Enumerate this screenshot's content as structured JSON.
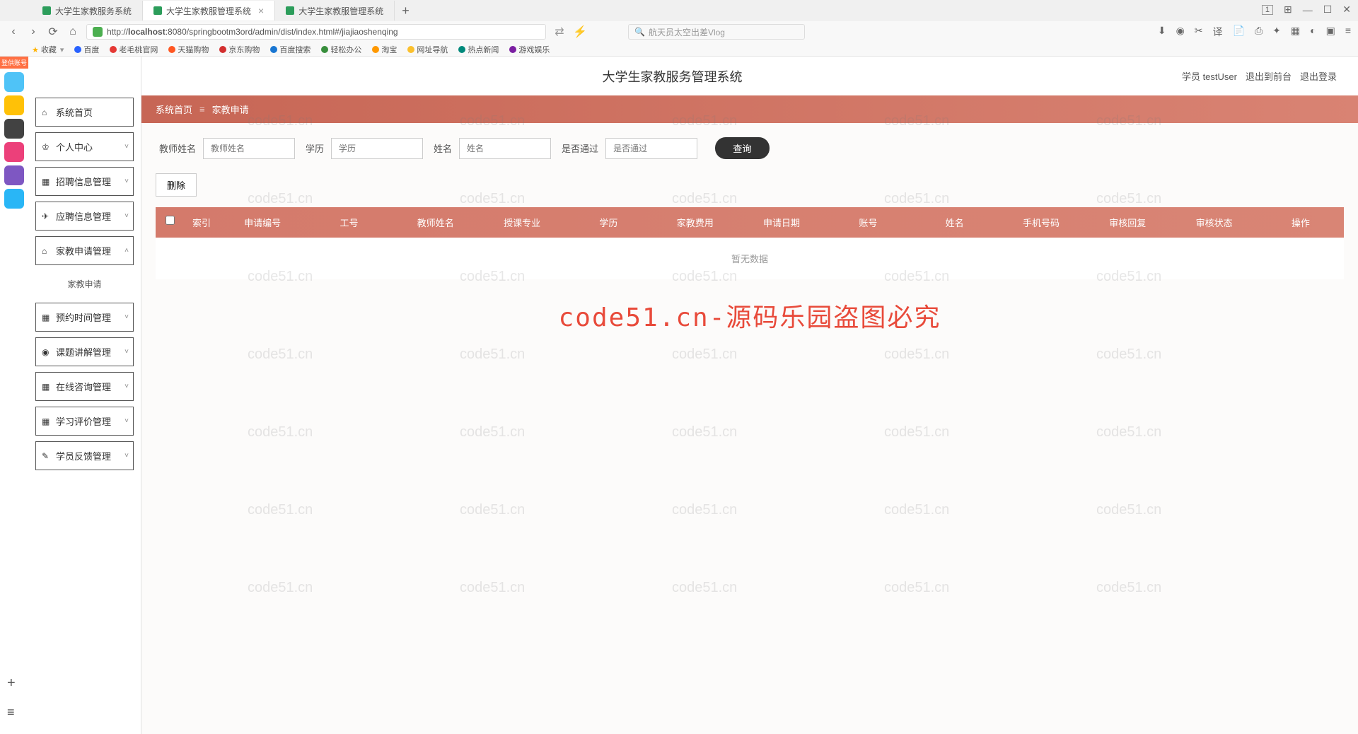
{
  "browser": {
    "tabs": [
      {
        "title": "大学生家教服务系统",
        "active": false
      },
      {
        "title": "大学生家教服管理系统",
        "active": true
      },
      {
        "title": "大学生家教服管理系统",
        "active": false
      }
    ],
    "url_prefix": "http://",
    "url_host": "localhost",
    "url_path": ":8080/springbootm3ord/admin/dist/index.html#/jiajiaoshenqing",
    "search_placeholder": "航天员太空出差Vlog",
    "win_num": "1",
    "bookmarks": [
      {
        "label": "收藏",
        "color": "#ffb300"
      },
      {
        "label": "百度",
        "color": "#2962ff"
      },
      {
        "label": "老毛桃官网",
        "color": "#e53935"
      },
      {
        "label": "天猫购物",
        "color": "#ff5722"
      },
      {
        "label": "京东购物",
        "color": "#d32f2f"
      },
      {
        "label": "百度搜索",
        "color": "#1976d2"
      },
      {
        "label": "轻松办公",
        "color": "#388e3c"
      },
      {
        "label": "淘宝",
        "color": "#ff9800"
      },
      {
        "label": "网址导航",
        "color": "#fbc02d"
      },
      {
        "label": "热点新闻",
        "color": "#00897b"
      },
      {
        "label": "游戏娱乐",
        "color": "#7b1fa2"
      }
    ]
  },
  "dock": {
    "login_badge": "登供账号",
    "items": [
      {
        "color": "#4fc3f7"
      },
      {
        "color": "#ffc107"
      },
      {
        "color": "#424242"
      },
      {
        "color": "#ec407a"
      },
      {
        "color": "#7e57c2"
      },
      {
        "color": "#29b6f6"
      }
    ]
  },
  "sidebar": {
    "items": [
      {
        "icon": "⌂",
        "label": "系统首页",
        "chevron": ""
      },
      {
        "icon": "♔",
        "label": "个人中心",
        "chevron": "˅"
      },
      {
        "icon": "▦",
        "label": "招聘信息管理",
        "chevron": "˅"
      },
      {
        "icon": "✈",
        "label": "应聘信息管理",
        "chevron": "˅"
      },
      {
        "icon": "⌂",
        "label": "家教申请管理",
        "chevron": "˄",
        "expanded": true,
        "sub": "家教申请"
      },
      {
        "icon": "▦",
        "label": "预约时间管理",
        "chevron": "˅"
      },
      {
        "icon": "◉",
        "label": "课题讲解管理",
        "chevron": "˅"
      },
      {
        "icon": "▦",
        "label": "在线咨询管理",
        "chevron": "˅"
      },
      {
        "icon": "▦",
        "label": "学习评价管理",
        "chevron": "˅"
      },
      {
        "icon": "✎",
        "label": "学员反馈管理",
        "chevron": "˅"
      }
    ]
  },
  "header": {
    "title": "大学生家教服务管理系统",
    "user_role": "学员 testUser",
    "exit_front": "退出到前台",
    "logout": "退出登录"
  },
  "breadcrumb": {
    "home": "系统首页",
    "current": "家教申请"
  },
  "filters": {
    "f1_label": "教师姓名",
    "f1_ph": "教师姓名",
    "f2_label": "学历",
    "f2_ph": "学历",
    "f3_label": "姓名",
    "f3_ph": "姓名",
    "f4_label": "是否通过",
    "f4_ph": "是否通过",
    "query_btn": "查询"
  },
  "actions": {
    "delete_btn": "删除"
  },
  "table": {
    "headers": [
      "索引",
      "申请编号",
      "工号",
      "教师姓名",
      "授课专业",
      "学历",
      "家教费用",
      "申请日期",
      "账号",
      "姓名",
      "手机号码",
      "审核回复",
      "审核状态",
      "操作"
    ],
    "empty_text": "暂无数据"
  },
  "watermarks": {
    "center": "code51.cn-源码乐园盗图必究",
    "small": "code51.cn"
  }
}
